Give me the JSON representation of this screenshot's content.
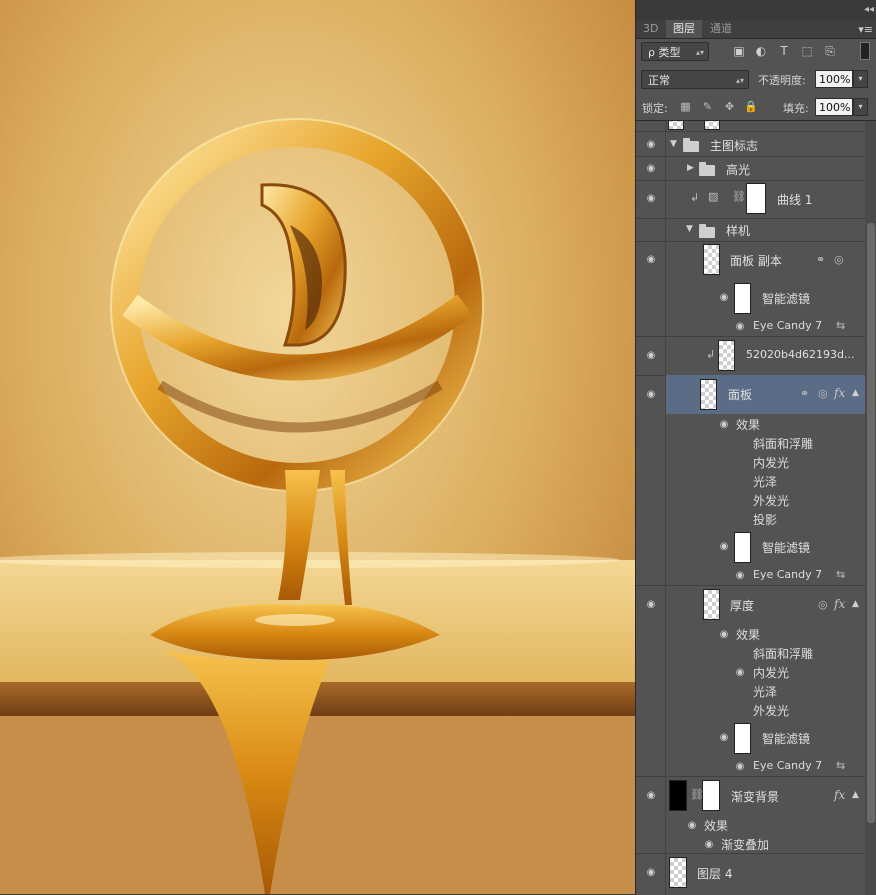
{
  "tabs": [
    {
      "label": "3D"
    },
    {
      "label": "图层"
    },
    {
      "label": "通道"
    }
  ],
  "filter": {
    "label": "ρ 类型"
  },
  "blend": {
    "mode": "正常",
    "opacity_label": "不透明度:",
    "opacity_value": "100%"
  },
  "lock": {
    "label": "锁定:",
    "fill_label": "填充:",
    "fill_value": "100%"
  },
  "layers": {
    "group_main": "主图标志",
    "group_highlight": "高光",
    "curves": "曲线 1",
    "group_sample": "样机",
    "panel_copy": "面板 副本",
    "smart_filters_1": "智能滤镜",
    "eye_candy_1": "Eye Candy 7",
    "hash_layer": "52020b4d62193d...",
    "panel": "面板",
    "effects_1": "效果",
    "fx_bevel_1": "斜面和浮雕",
    "fx_inner_glow_1": "内发光",
    "fx_satin_1": "光泽",
    "fx_outer_glow_1": "外发光",
    "fx_shadow_1": "投影",
    "smart_filters_2": "智能滤镜",
    "eye_candy_2": "Eye Candy 7",
    "thickness": "厚度",
    "effects_2": "效果",
    "fx_bevel_2": "斜面和浮雕",
    "fx_inner_glow_2": "内发光",
    "fx_satin_2": "光泽",
    "fx_outer_glow_2": "外发光",
    "smart_filters_3": "智能滤镜",
    "eye_candy_3": "Eye Candy 7",
    "gradient_bg": "渐变背景",
    "effects_3": "效果",
    "fx_gradient_overlay": "渐变叠加",
    "layer4": "图层 4"
  },
  "icons": {
    "eye": "eye-icon",
    "folder": "folder-icon",
    "link": "link-icon",
    "fx": "fx-icon"
  }
}
